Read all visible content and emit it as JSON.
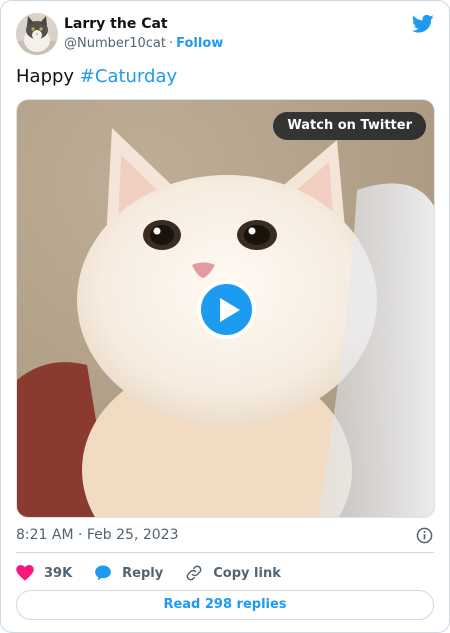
{
  "author": {
    "display_name": "Larry the Cat",
    "handle": "@Number10cat",
    "separator": "·",
    "follow_label": "Follow"
  },
  "tweet": {
    "text_prefix": "Happy ",
    "hashtag": "#Caturday"
  },
  "media": {
    "watch_label": "Watch on Twitter",
    "play_icon": "play-icon"
  },
  "meta": {
    "timestamp": "8:21 AM · Feb 25, 2023",
    "info_icon": "info-icon"
  },
  "actions": {
    "likes": "39K",
    "reply_label": "Reply",
    "copy_link_label": "Copy link"
  },
  "read_replies_label": "Read 298 replies",
  "colors": {
    "accent": "#1d9bf0",
    "like": "#f91880",
    "muted": "#536471",
    "border": "#cfd9de"
  }
}
